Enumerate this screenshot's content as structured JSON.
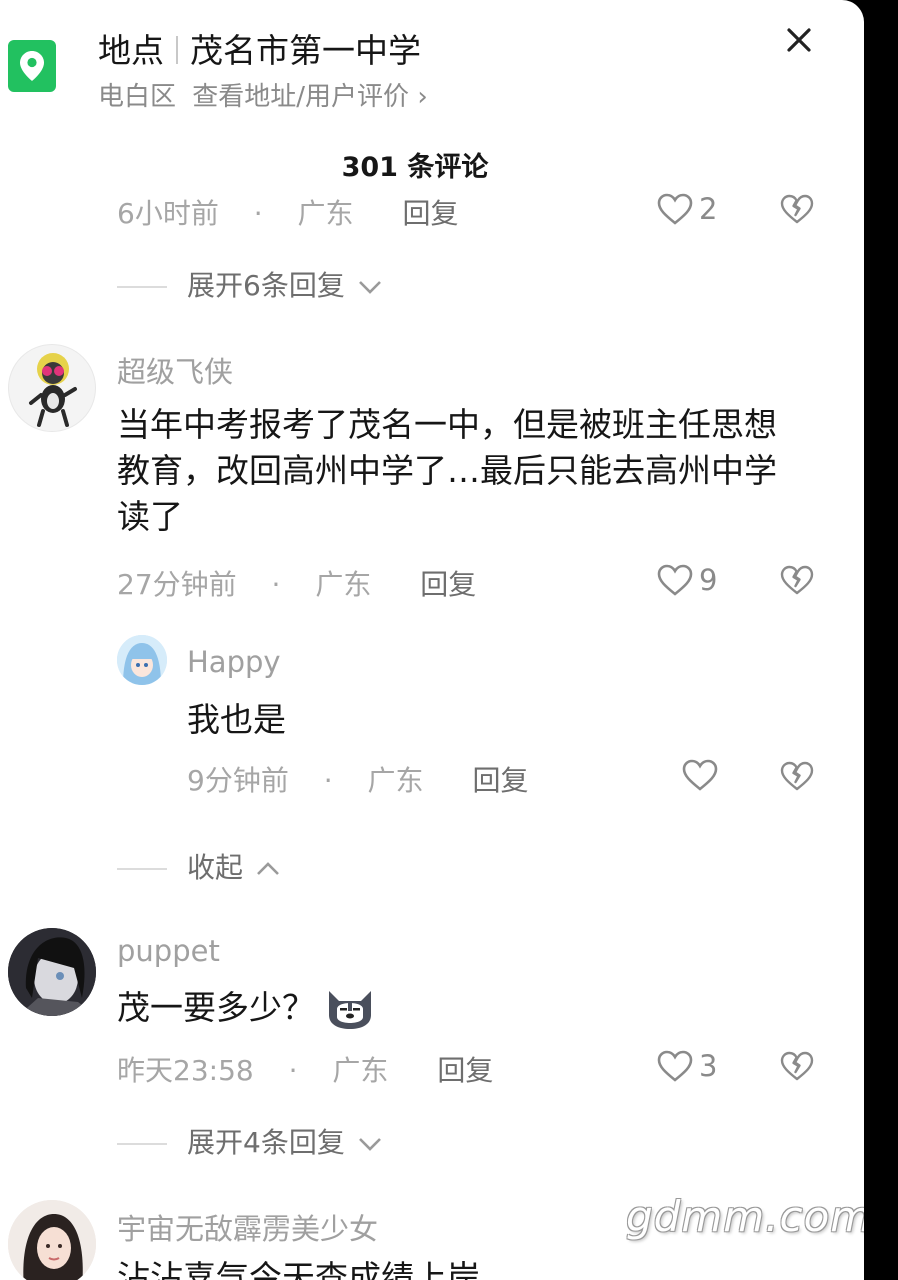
{
  "location": {
    "label": "地点",
    "name": "茂名市第一中学",
    "district": "电白区",
    "link": "查看地址/用户评价",
    "link_arrow": "›",
    "icon": "map-pin-icon",
    "accent": "#22c160"
  },
  "comments_count": "301 条评论",
  "top_fragment": {
    "time": "6小时前",
    "region": "广东",
    "reply": "回复",
    "likes": "2"
  },
  "expand_first": "展开6条回复",
  "comments": [
    {
      "name": "超级飞侠",
      "text": "当年中考报考了茂名一中，但是被班主任思想教育，改回高州中学了…最后只能去高州中学读了",
      "time": "27分钟前",
      "region": "广东",
      "reply": "回复",
      "likes": "9",
      "sub": {
        "name": "Happy",
        "text": "我也是",
        "time": "9分钟前",
        "region": "广东",
        "reply": "回复",
        "likes": ""
      },
      "collapse": "收起"
    },
    {
      "name": "puppet",
      "text": "茂一要多少？",
      "emoji": "husky-emoji",
      "time": "昨天23:58",
      "region": "广东",
      "reply": "回复",
      "likes": "3",
      "expand": "展开4条回复"
    },
    {
      "name": "宇宙无敌霹雳美少女",
      "text": "沾沾喜气今天查成绩上岸"
    }
  ],
  "dot": "·",
  "watermark": "gdmm.com"
}
